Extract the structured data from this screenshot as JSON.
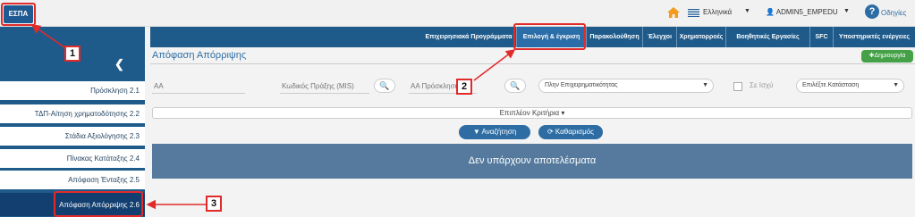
{
  "topbar": {
    "logo": "ΕΣΠΑ",
    "language": "Ελληνικά",
    "user": "ADMIN5_EMPEDU",
    "help": "Οδηγίες",
    "help_symbol": "?"
  },
  "nav": {
    "items": [
      {
        "label": "Επιχειρησιακά Προγράμματα"
      },
      {
        "label": "Επιλογή & έγκριση"
      },
      {
        "label": "Παρακολούθηση"
      },
      {
        "label": "Έλεγχοι"
      },
      {
        "label": "Χρηματορροές"
      },
      {
        "label": "Βοηθητικές Εργασίες"
      },
      {
        "label": "SFC"
      },
      {
        "label": "Υποστηρικτές ενέργειες"
      }
    ]
  },
  "sidebar": {
    "toggle": "❮",
    "items": [
      {
        "label": "Πρόσκληση 2.1"
      },
      {
        "label": "ΤΔΠ-Αίτηση χρηματοδότησης 2.2"
      },
      {
        "label": "Στάδια Αξιολόγησης 2.3"
      },
      {
        "label": "Πίνακας Κατάταξης 2.4"
      },
      {
        "label": "Απόφαση Ένταξης 2.5"
      },
      {
        "label": "Απόφαση Απόρριψης 2.6"
      }
    ]
  },
  "page": {
    "title": "Απόφαση Απόρριψης",
    "create_label": "✚Δημιουργία"
  },
  "filters": {
    "aa_placeholder": "ΑΑ",
    "mis_placeholder": "Κωδικός Πράξης (MIS)",
    "call_placeholder": "ΑΑ Πρόσκλησης",
    "program_select": "Πλην Επιχειρηματικότητας",
    "active_label": "Σε Ισχύ",
    "status_select": "Επιλέξτε Κατάσταση"
  },
  "more_criteria": "Επιπλέον Κριτήρια ▾",
  "buttons": {
    "search": "Αναζήτηση",
    "clear": "Καθαρισμός"
  },
  "results_message": "Δεν υπάρχουν αποτελέσματα",
  "callouts": [
    "1",
    "2",
    "3"
  ],
  "colors": {
    "nav": "#1e5a8a",
    "highlight": "#e12b2b",
    "create": "#44a147",
    "results": "#557a9d"
  }
}
